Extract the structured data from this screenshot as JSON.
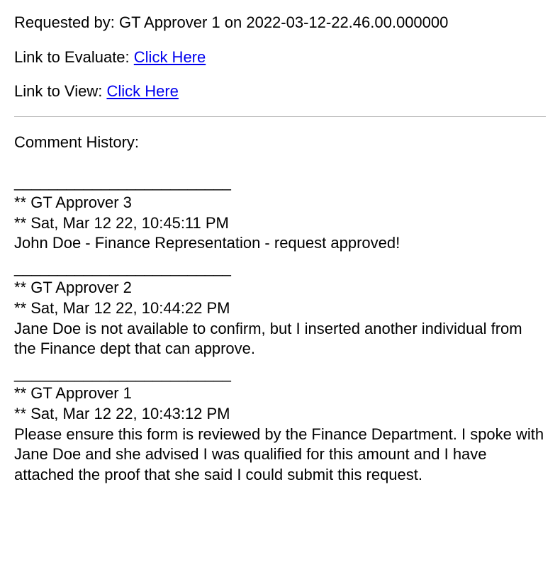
{
  "header": {
    "requested_by_line": "Requested by: GT Approver 1 on 2022-03-12-22.46.00.000000",
    "evaluate_label": "Link to Evaluate: ",
    "evaluate_link_text": "Click Here",
    "view_label": "Link to View: ",
    "view_link_text": "Click Here"
  },
  "history": {
    "title": "Comment History:",
    "separator": "_________________________",
    "entries": [
      {
        "approver_line": "** GT Approver 3",
        "timestamp_line": "** Sat, Mar 12 22, 10:45:11 PM",
        "body": "John Doe - Finance Representation - request approved!"
      },
      {
        "approver_line": "** GT Approver 2",
        "timestamp_line": "** Sat, Mar 12 22, 10:44:22 PM",
        "body": "Jane Doe is not available to confirm, but I inserted another individual from the Finance dept that can approve."
      },
      {
        "approver_line": "** GT Approver 1",
        "timestamp_line": "** Sat, Mar 12 22, 10:43:12 PM",
        "body": "Please ensure this form is reviewed by the Finance Department. I spoke with Jane Doe and she advised I was qualified for this amount and I have attached the proof that she said I could submit this request."
      }
    ]
  }
}
